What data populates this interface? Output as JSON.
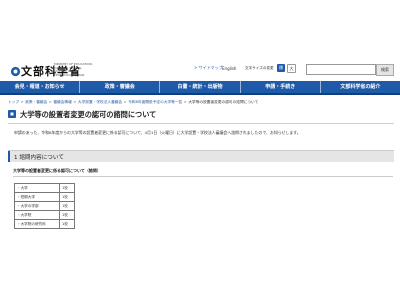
{
  "header": {
    "logo_text": "文部科学省",
    "logo_en": "MINISTRY OF EDUCATION, CULTURE, SPORTS, SCIENCE AND TECHNOLOGY-JAPAN",
    "sitemap_link": "> サイトマップ",
    "english_link": "English",
    "text_size_label": "文字サイズの変更",
    "size_standard": "標",
    "size_large": "大",
    "search_button": "検索"
  },
  "nav": {
    "items": [
      {
        "label": "会見・報道・お知らせ"
      },
      {
        "label": "政策・審議会"
      },
      {
        "label": "白書・統計・出版物"
      },
      {
        "label": "申請・手続き"
      },
      {
        "label": "文部科学省の紹介"
      }
    ]
  },
  "breadcrumb": {
    "items": [
      "トップ",
      "政策・審議会",
      "審議会情報",
      "大学設置・学校法人審議会",
      "令和6年度開設予定の大学等一覧"
    ],
    "current": "大学等の設置者変更の認可の諮問について"
  },
  "page": {
    "title": "大学等の設置者変更の認可の諮問について",
    "intro": "申請のあった、令和6年度からの大学等の設置者変更に係る認可について、4月1日（火曜日）に大学設置・学校法人審議会へ諮問されましたので、お知らせします。",
    "section_title": "1 諮問内容について",
    "subheading": "大学等の設置者変更に係る認可について（諮問）"
  },
  "table": {
    "rows": [
      {
        "label": "・大学",
        "value": "1校"
      },
      {
        "label": "・短期大学",
        "value": "1校"
      },
      {
        "label": "・大学の学部",
        "value": "1校"
      },
      {
        "label": "・大学院",
        "value": "1校"
      },
      {
        "label": "・大学院の研究科",
        "value": "1校"
      }
    ]
  },
  "colors": {
    "nav_bg": "#1f5aa8",
    "accent": "#1f5aa8"
  }
}
